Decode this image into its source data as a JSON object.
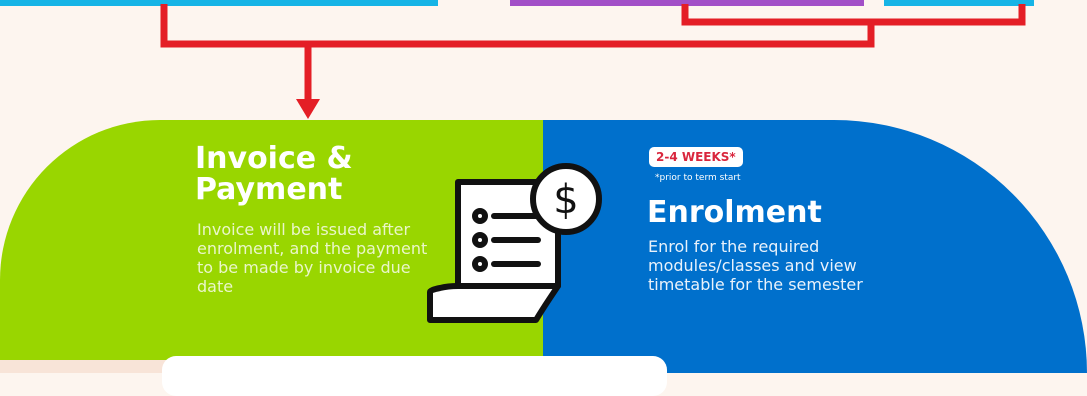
{
  "colors": {
    "background": "#fdf5ef",
    "green": "#99d600",
    "blue": "#0070cc",
    "connector": "#e41e26",
    "cyan": "#16b4e6",
    "purple": "#a24fc7",
    "badge_text": "#d9263d"
  },
  "invoice": {
    "title": "Invoice & Payment",
    "description": "Invoice will be issued after enrolment, and the payment to be made by invoice due date",
    "icon": "invoice-dollar-icon"
  },
  "enrolment": {
    "badge": "2-4 WEEKS*",
    "badge_note": "*prior to term start",
    "title": "Enrolment",
    "description": "Enrol for the required modules/classes and view timetable for the semester"
  }
}
